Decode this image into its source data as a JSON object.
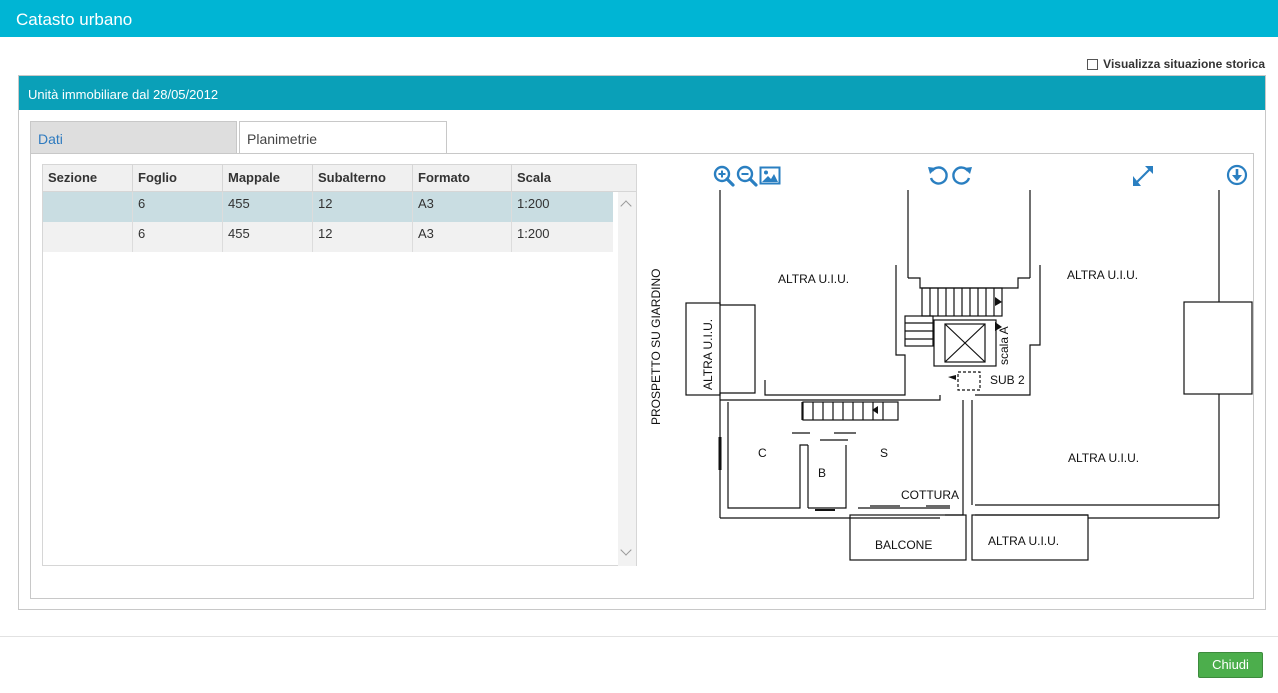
{
  "window": {
    "title": "Catasto urbano"
  },
  "history_toggle": {
    "label": "Visualizza situazione storica",
    "checked": false
  },
  "panel": {
    "heading": "Unità immobiliare dal 28/05/2012"
  },
  "tabs": [
    {
      "label": "Dati",
      "active": false
    },
    {
      "label": "Planimetrie",
      "active": true
    }
  ],
  "table": {
    "columns": [
      "Sezione",
      "Foglio",
      "Mappale",
      "Subalterno",
      "Formato",
      "Scala"
    ],
    "rows": [
      {
        "sezione": "",
        "foglio": "6",
        "mappale": "455",
        "subalterno": "12",
        "formato": "A3",
        "scala": "1:200",
        "selected": true
      },
      {
        "sezione": "",
        "foglio": "6",
        "mappale": "455",
        "subalterno": "12",
        "formato": "A3",
        "scala": "1:200",
        "selected": false
      }
    ]
  },
  "viewer_toolbar": {
    "icons": [
      "zoom-in-icon",
      "zoom-out-icon",
      "image-icon",
      "rotate-left-icon",
      "rotate-right-icon",
      "fullscreen-icon",
      "download-icon"
    ],
    "accent": "#2a7fc1"
  },
  "floorplan": {
    "labels": {
      "altra_top_left": "ALTRA U.I.U.",
      "altra_top_right": "ALTRA U.I.U.",
      "altra_left": "ALTRA U.I.U.",
      "altra_right": "ALTRA U.I.U.",
      "altra_bottom": "ALTRA U.I.U.",
      "prospetto": "PROSPETTO SU GIARDINO",
      "scala_a": "scala A",
      "sub2": "SUB 2",
      "room_c": "C",
      "room_b": "B",
      "room_s": "S",
      "cottura": "COTTURA",
      "balcone": "BALCONE"
    }
  },
  "footer": {
    "close_label": "Chiudi"
  },
  "colors": {
    "header": "#00b5d4",
    "panel_header": "#0aa0b8",
    "close_button": "#4cae4c",
    "selected_row": "#c9dde2"
  }
}
